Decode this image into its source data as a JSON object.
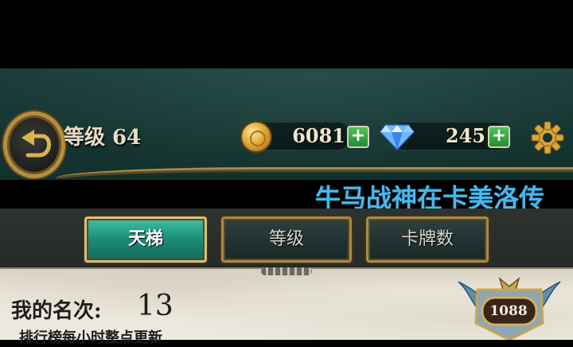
{
  "header": {
    "level_text": "等级 64",
    "gold": "6081",
    "diamonds": "245",
    "plus_symbol": "+",
    "marquee": "牛马战神在卡美洛传"
  },
  "tabs": [
    {
      "label": "天梯",
      "active": true
    },
    {
      "label": "等级",
      "active": false
    },
    {
      "label": "卡牌数",
      "active": false
    }
  ],
  "ranking": {
    "my_rank_label": "我的名次:",
    "my_rank_value": "13",
    "update_note": "排行榜每小时整点更新",
    "badge_score": "1088"
  },
  "icons": {
    "back": "back-arrow-icon",
    "coin": "gold-coin-icon",
    "gem": "diamond-icon",
    "settings": "gear-icon",
    "rank_badge": "rank-shield-badge"
  },
  "colors": {
    "header_bg": "#173532",
    "gold_trim": "#b48f3f",
    "active_tab": "#1b8b78",
    "marquee_text": "#47b8ea",
    "plus_green": "#2fa23e"
  }
}
